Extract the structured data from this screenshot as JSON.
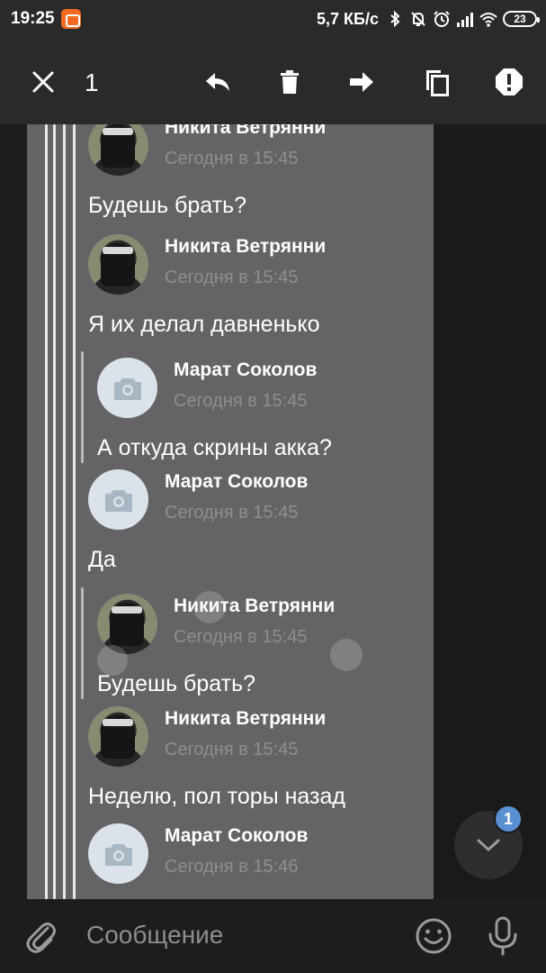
{
  "status_bar": {
    "time": "19:25",
    "network_speed": "5,7 КБ/с",
    "battery": "23",
    "icons": [
      "notification-app-icon",
      "bluetooth-icon",
      "mute-icon",
      "alarm-icon",
      "signal-icon",
      "wifi-icon",
      "battery-icon"
    ]
  },
  "toolbar": {
    "selected_count": "1",
    "actions": [
      "close-icon",
      "reply-icon",
      "delete-icon",
      "forward-icon",
      "copy-icon",
      "report-icon"
    ]
  },
  "messages": [
    {
      "author": "Никита Ветрянни",
      "time": "Сегодня в 15:45",
      "text": "Будешь брать?",
      "avatar": "photo"
    },
    {
      "author": "Никита Ветрянни",
      "time": "Сегодня в 15:45",
      "text": "Я их делал давненько",
      "avatar": "photo"
    },
    {
      "author": "Марат Соколов",
      "time": "Сегодня в 15:45",
      "text": "А откуда скрины акка?",
      "avatar": "camera",
      "quoted": true
    },
    {
      "author": "Марат Соколов",
      "time": "Сегодня в 15:45",
      "text": "Да",
      "avatar": "camera"
    },
    {
      "author": "Никита Ветрянни",
      "time": "Сегодня в 15:45",
      "text": "Будешь брать?",
      "avatar": "photo",
      "quoted": true
    },
    {
      "author": "Никита Ветрянни",
      "time": "Сегодня в 15:45",
      "text": "Неделю, пол торы назад",
      "avatar": "photo"
    },
    {
      "author": "Марат Соколов",
      "time": "Сегодня в 15:46",
      "text": "",
      "avatar": "camera"
    }
  ],
  "scroll_button": {
    "badge": "1"
  },
  "composer": {
    "placeholder": "Сообщение"
  },
  "colors": {
    "bar_background": "#2a2a2a",
    "forward_card": "#646466",
    "badge": "#5a8fd2",
    "camera_avatar": "#dbe2ea"
  }
}
